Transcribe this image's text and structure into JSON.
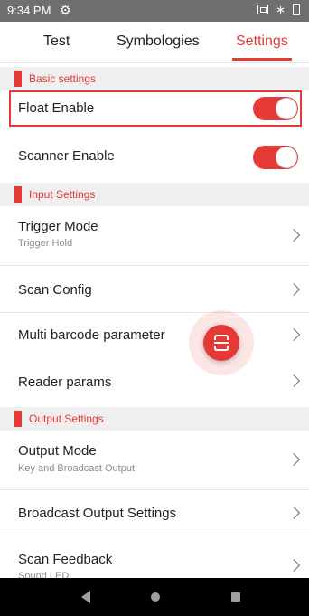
{
  "status_bar": {
    "time": "9:34 PM",
    "gear_glyph": "⚙",
    "bt_glyph": "∗"
  },
  "tabs": [
    {
      "label": "Test"
    },
    {
      "label": "Symbologies"
    },
    {
      "label": "Settings",
      "active": true
    }
  ],
  "sections": {
    "basic": "Basic settings",
    "input": "Input Settings",
    "output": "Output Settings"
  },
  "rows": {
    "float_enable": {
      "label": "Float Enable",
      "on": true
    },
    "scanner_enable": {
      "label": "Scanner Enable",
      "on": true
    },
    "trigger_mode": {
      "label": "Trigger Mode",
      "sub": "Trigger Hold"
    },
    "scan_config": {
      "label": "Scan Config"
    },
    "multi_barcode": {
      "label": "Multi barcode parameter"
    },
    "reader_params": {
      "label": "Reader params"
    },
    "output_mode": {
      "label": "Output Mode",
      "sub": "Key and Broadcast Output"
    },
    "broadcast_output": {
      "label": "Broadcast Output Settings"
    },
    "scan_feedback": {
      "label": "Scan Feedback",
      "sub": "Sound LED"
    }
  },
  "colors": {
    "accent": "#e53935",
    "status_bar": "#6f6f6f",
    "section_bg": "#efefef"
  },
  "icons": [
    "settings-gear-icon",
    "screenshot-icon",
    "bluetooth-icon",
    "battery-icon",
    "chevron-right-icon",
    "scan-icon",
    "back-icon",
    "home-icon",
    "recents-icon"
  ]
}
